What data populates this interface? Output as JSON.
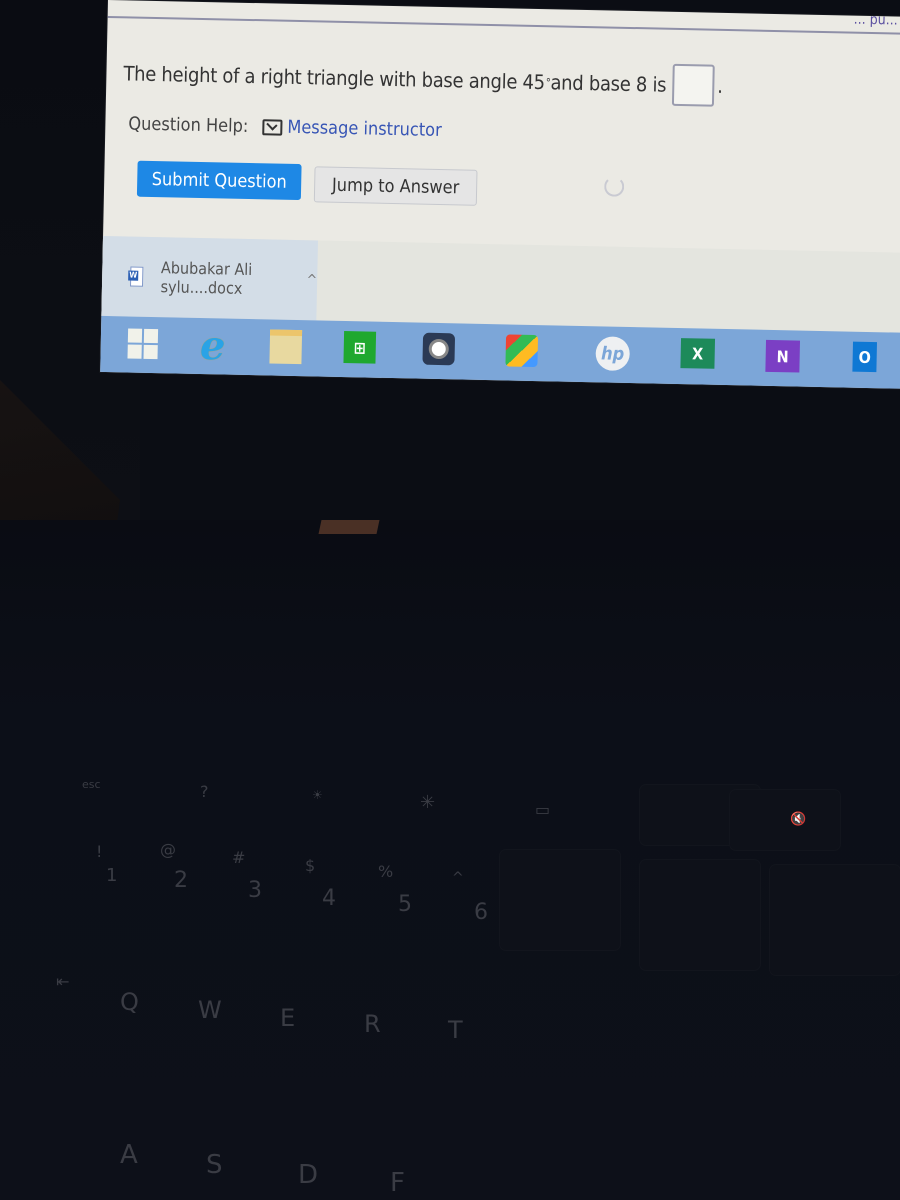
{
  "page": {
    "top_fragment": "... pu...",
    "question": {
      "prefix": "The height of a right triangle with base angle 45",
      "degree": "°",
      "suffix": " and base 8 is",
      "answer_value": "",
      "period": "."
    },
    "help": {
      "label": "Question Help:",
      "link": "Message instructor"
    },
    "buttons": {
      "submit": "Submit Question",
      "jump": "Jump to Answer"
    }
  },
  "downloads": {
    "items": [
      {
        "icon": "word-doc-icon",
        "name": "Abubakar Ali sylu....docx"
      }
    ],
    "chevron": "^"
  },
  "taskbar": {
    "icons": [
      {
        "name": "windows-start-icon"
      },
      {
        "name": "internet-explorer-icon",
        "glyph": "e"
      },
      {
        "name": "file-explorer-icon"
      },
      {
        "name": "windows-store-icon",
        "glyph": "⊞"
      },
      {
        "name": "webcam-app-icon"
      },
      {
        "name": "puzzle-app-icon"
      },
      {
        "name": "hp-icon",
        "glyph": "hp"
      },
      {
        "name": "excel-icon",
        "glyph": "X"
      },
      {
        "name": "onenote-icon",
        "glyph": "N"
      },
      {
        "name": "outlook-icon",
        "glyph": "O"
      }
    ]
  },
  "keyboard": {
    "fn_row": [
      "esc",
      "?",
      "☀",
      "✳",
      "▭",
      "🔇"
    ],
    "number_row": [
      {
        "top": "!",
        "main": "1"
      },
      {
        "top": "@",
        "main": "2"
      },
      {
        "top": "#",
        "main": "3"
      },
      {
        "top": "$",
        "main": "4"
      },
      {
        "top": "%",
        "main": "5"
      },
      {
        "top": "^",
        "main": "6"
      }
    ],
    "tab": "⇤",
    "qwerty_row": [
      "Q",
      "W",
      "E",
      "R",
      "T"
    ],
    "asdf_row": [
      "A",
      "S",
      "D",
      "F"
    ]
  }
}
